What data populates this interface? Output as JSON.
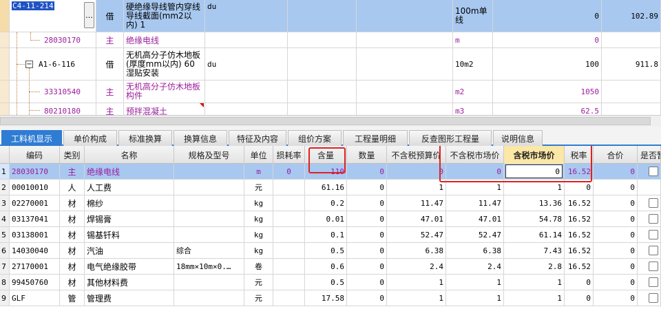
{
  "top_rows": [
    {
      "code": "C4-11-214",
      "category": "借",
      "name": "硬绝缘导线管内穿线 导线截面(mm2以内) 1",
      "spec": "du",
      "unit": "100m单线",
      "qty": "0",
      "price": "102.89"
    },
    {
      "code": "28030170",
      "category": "主",
      "name": "绝缘电线",
      "spec": "",
      "unit": "m",
      "qty": "0",
      "price": ""
    },
    {
      "code": "A1-6-116",
      "category": "借",
      "name": "无机高分子仿木地板 (厚度mm以内) 60 湿贴安装",
      "spec": "du",
      "unit": "10m2",
      "qty": "100",
      "price": "911.8"
    },
    {
      "code": "33310540",
      "category": "主",
      "name": "无机高分子仿木地板构件",
      "spec": "",
      "unit": "m2",
      "qty": "1050",
      "price": ""
    },
    {
      "code": "80210180",
      "category": "主",
      "name": "预拌混凝土",
      "spec": "",
      "unit": "m3",
      "qty": "62.5",
      "price": ""
    }
  ],
  "ellipsis_label": "…",
  "expander_label": "−",
  "tabs": [
    "工料机显示",
    "单价构成",
    "标准换算",
    "换算信息",
    "特征及内容",
    "组价方案",
    "工程量明细",
    "反查图形工程量",
    "说明信息"
  ],
  "columns": [
    "编码",
    "类别",
    "名称",
    "规格及型号",
    "单位",
    "损耗率",
    "含量",
    "数量",
    "不含税预算价",
    "不含税市场价",
    "含税市场价",
    "税率",
    "合价",
    "是否暂"
  ],
  "rows": [
    {
      "n": "1",
      "code": "28030170",
      "cat": "主",
      "name": "绝缘电线",
      "spec": "",
      "unit": "m",
      "loss": "0",
      "content": "110",
      "qty": "0",
      "budget": "0",
      "market": "0",
      "market_tax": "0",
      "rate": "16.52",
      "total": "0"
    },
    {
      "n": "2",
      "code": "00010010",
      "cat": "人",
      "name": "人工费",
      "spec": "",
      "unit": "元",
      "loss": "",
      "content": "61.16",
      "qty": "0",
      "budget": "1",
      "market": "1",
      "market_tax": "1",
      "rate": "0",
      "total": "0"
    },
    {
      "n": "3",
      "code": "02270001",
      "cat": "材",
      "name": "棉纱",
      "spec": "",
      "unit": "kg",
      "loss": "",
      "content": "0.2",
      "qty": "0",
      "budget": "11.47",
      "market": "11.47",
      "market_tax": "13.36",
      "rate": "16.52",
      "total": "0"
    },
    {
      "n": "4",
      "code": "03137041",
      "cat": "材",
      "name": "焊锡膏",
      "spec": "",
      "unit": "kg",
      "loss": "",
      "content": "0.01",
      "qty": "0",
      "budget": "47.01",
      "market": "47.01",
      "market_tax": "54.78",
      "rate": "16.52",
      "total": "0"
    },
    {
      "n": "5",
      "code": "03138001",
      "cat": "材",
      "name": "锡基钎料",
      "spec": "",
      "unit": "kg",
      "loss": "",
      "content": "0.1",
      "qty": "0",
      "budget": "52.47",
      "market": "52.47",
      "market_tax": "61.14",
      "rate": "16.52",
      "total": "0"
    },
    {
      "n": "6",
      "code": "14030040",
      "cat": "材",
      "name": "汽油",
      "spec": "综合",
      "unit": "kg",
      "loss": "",
      "content": "0.5",
      "qty": "0",
      "budget": "6.38",
      "market": "6.38",
      "market_tax": "7.43",
      "rate": "16.52",
      "total": "0"
    },
    {
      "n": "7",
      "code": "27170001",
      "cat": "材",
      "name": "电气绝缘胶带",
      "spec": "18mm×10m×0.…",
      "unit": "卷",
      "loss": "",
      "content": "0.6",
      "qty": "0",
      "budget": "2.4",
      "market": "2.4",
      "market_tax": "2.8",
      "rate": "16.52",
      "total": "0"
    },
    {
      "n": "8",
      "code": "99450760",
      "cat": "材",
      "name": "其他材料费",
      "spec": "",
      "unit": "元",
      "loss": "",
      "content": "0.5",
      "qty": "0",
      "budget": "1",
      "market": "1",
      "market_tax": "1",
      "rate": "0",
      "total": "0"
    },
    {
      "n": "9",
      "code": "GLF",
      "cat": "管",
      "name": "管理费",
      "spec": "",
      "unit": "元",
      "loss": "",
      "content": "17.58",
      "qty": "0",
      "budget": "1",
      "market": "1",
      "market_tax": "1",
      "rate": "0",
      "total": "0"
    }
  ],
  "colors": {
    "selection": "#a8c8f0",
    "accent": "#2f7cd3",
    "highlight_box": "#e02020",
    "main_material": "#9c1c9c"
  }
}
